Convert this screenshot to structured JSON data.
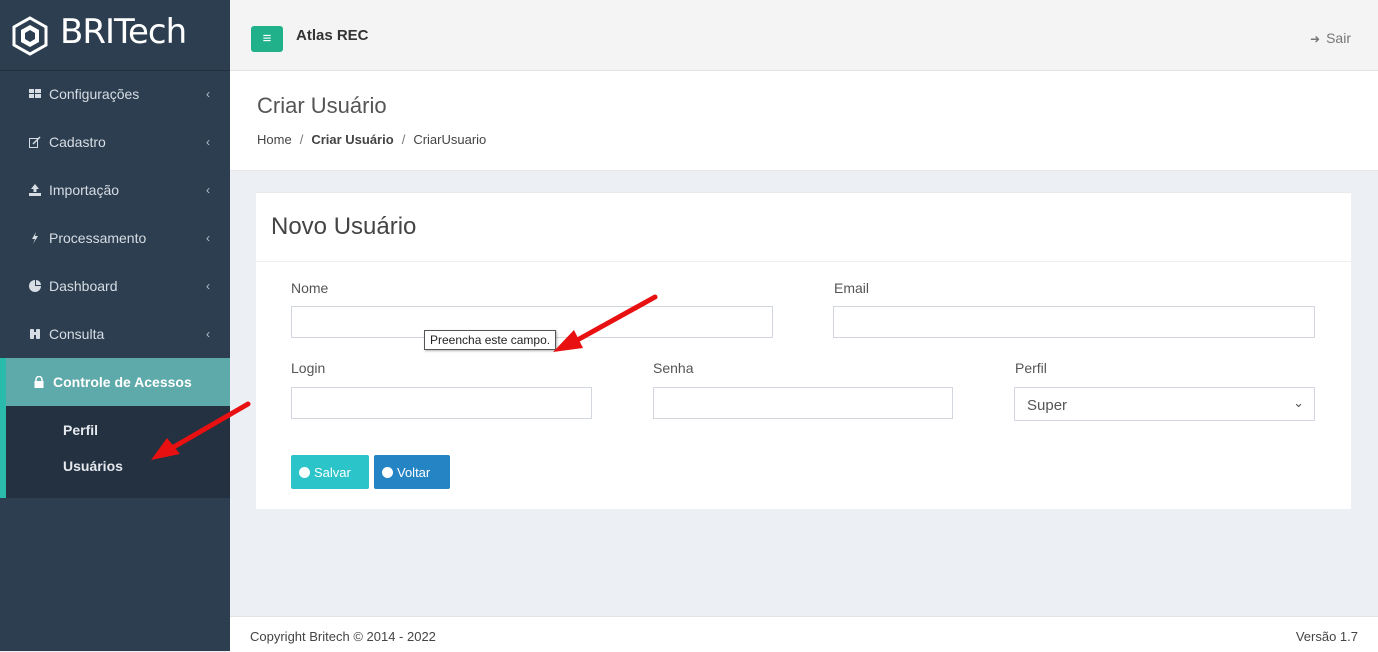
{
  "brand": {
    "name": "BRITech"
  },
  "header": {
    "app_title": "Atlas REC",
    "logout_label": "Sair",
    "menu_icon": "hamburger-icon"
  },
  "sidebar": {
    "items": [
      {
        "label": "Configurações",
        "icon": "grid-icon"
      },
      {
        "label": "Cadastro",
        "icon": "edit-icon"
      },
      {
        "label": "Importação",
        "icon": "upload-icon"
      },
      {
        "label": "Processamento",
        "icon": "bolt-icon"
      },
      {
        "label": "Dashboard",
        "icon": "pie-chart-icon"
      },
      {
        "label": "Consulta",
        "icon": "binoculars-icon"
      },
      {
        "label": "Controle de Acessos",
        "icon": "lock-icon",
        "active": true
      }
    ],
    "subitems": [
      {
        "label": "Perfil"
      },
      {
        "label": "Usuários"
      }
    ]
  },
  "page": {
    "title": "Criar Usuário",
    "breadcrumb": [
      "Home",
      "Criar Usuário",
      "CriarUsuario"
    ]
  },
  "form": {
    "title": "Novo Usuário",
    "fields": {
      "nome": {
        "label": "Nome",
        "value": ""
      },
      "email": {
        "label": "Email",
        "value": ""
      },
      "login": {
        "label": "Login",
        "value": ""
      },
      "senha": {
        "label": "Senha",
        "value": ""
      },
      "perfil": {
        "label": "Perfil",
        "value": "Super"
      }
    },
    "tooltip": "Preencha este campo.",
    "buttons": {
      "save": "Salvar",
      "back": "Voltar"
    }
  },
  "footer": {
    "copyright": "Copyright Britech © 2014 - 2022",
    "version": "Versão 1.7"
  },
  "colors": {
    "sidebar": "#2c3e50",
    "accent": "#20b18b",
    "active_item": "#5ea9a9",
    "save": "#2bc4c9",
    "back": "#2584c4",
    "annotation_arrow": "#e81010"
  }
}
